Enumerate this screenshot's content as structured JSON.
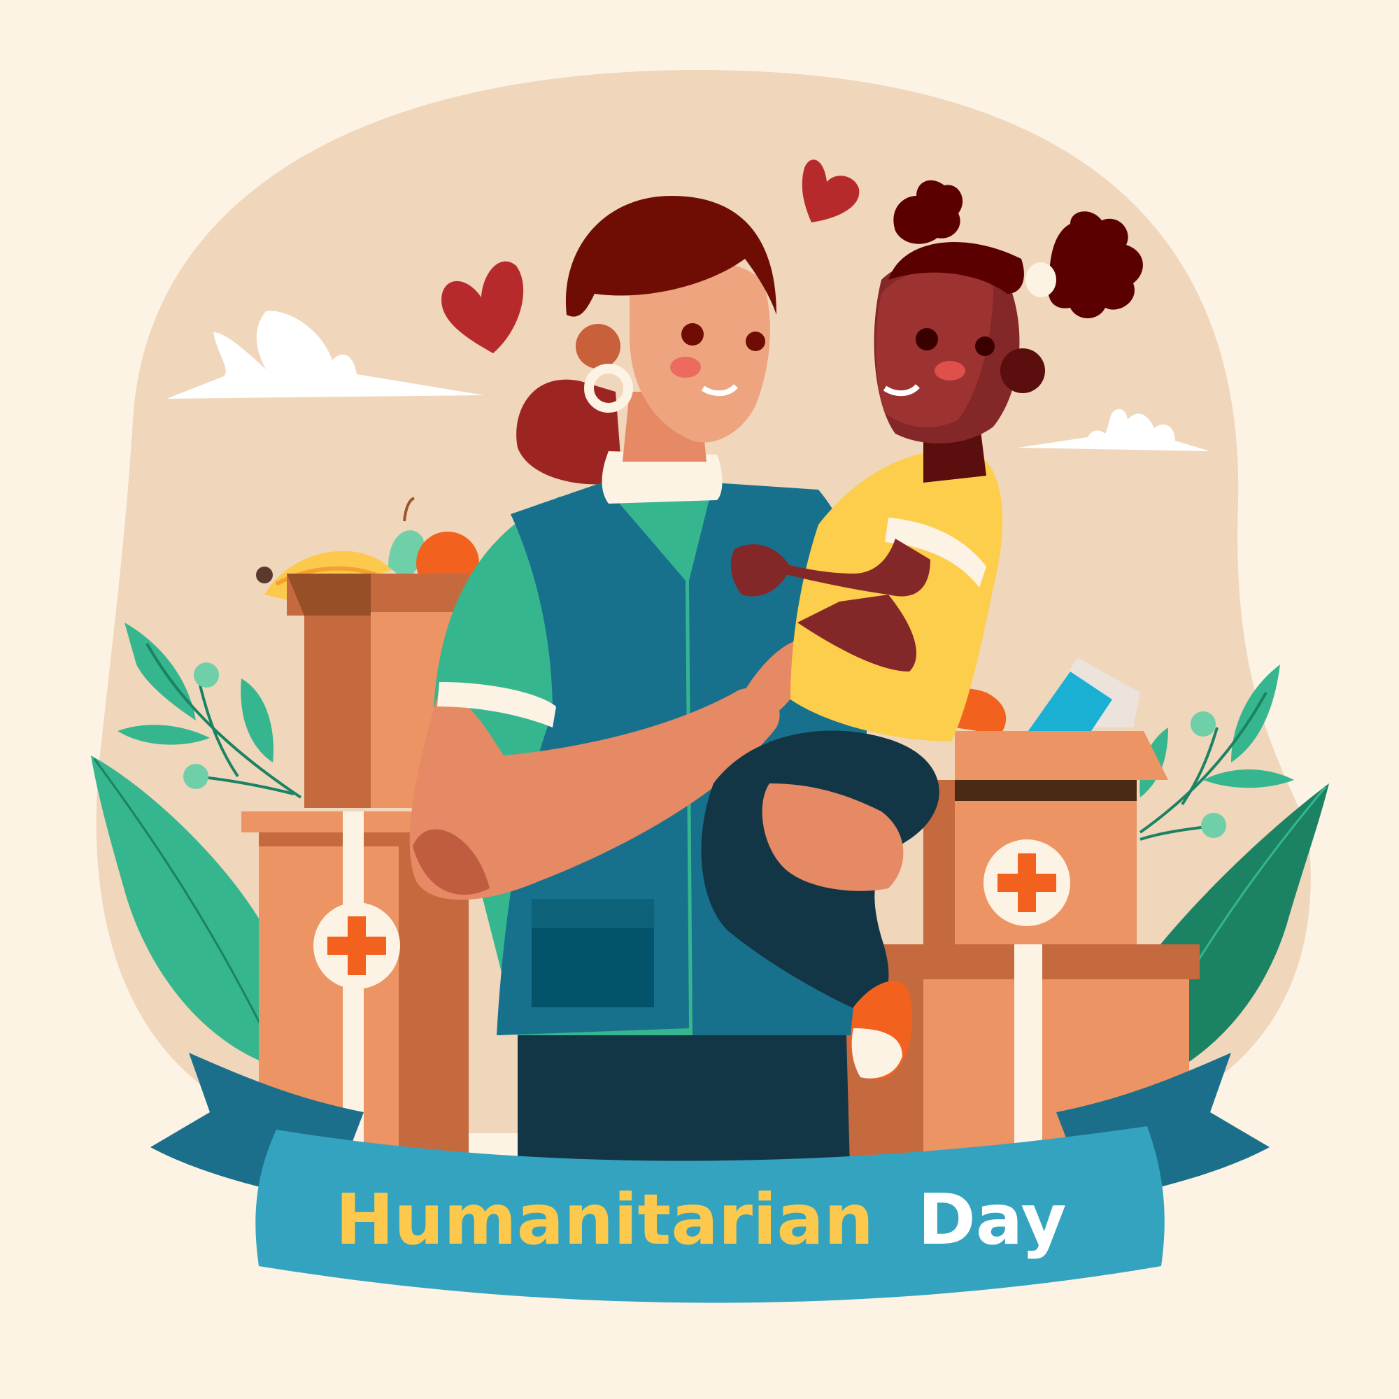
{
  "banner": {
    "word1": "Humanitarian",
    "word2": "Day",
    "word1_color": "#fdc94c",
    "word2_color": "#ffffff",
    "ribbon_color": "#34a3c0",
    "ribbon_dark": "#1b6f8a"
  },
  "colors": {
    "background": "#fdf3e4",
    "blob": "#f0d6bb",
    "leaf": "#36b68e",
    "leaf_dark": "#1b8264",
    "box": "#ec9463",
    "box_dark": "#c46a3e",
    "cross": "#f2621e",
    "vest": "#17718c",
    "shirt": "#36b68e",
    "child_shirt": "#fdcd4c",
    "heart": "#b72a2c"
  },
  "icons": [
    "heart-icon",
    "medical-cross-icon",
    "cloud-icon",
    "leaf-icon",
    "berry-icon"
  ]
}
